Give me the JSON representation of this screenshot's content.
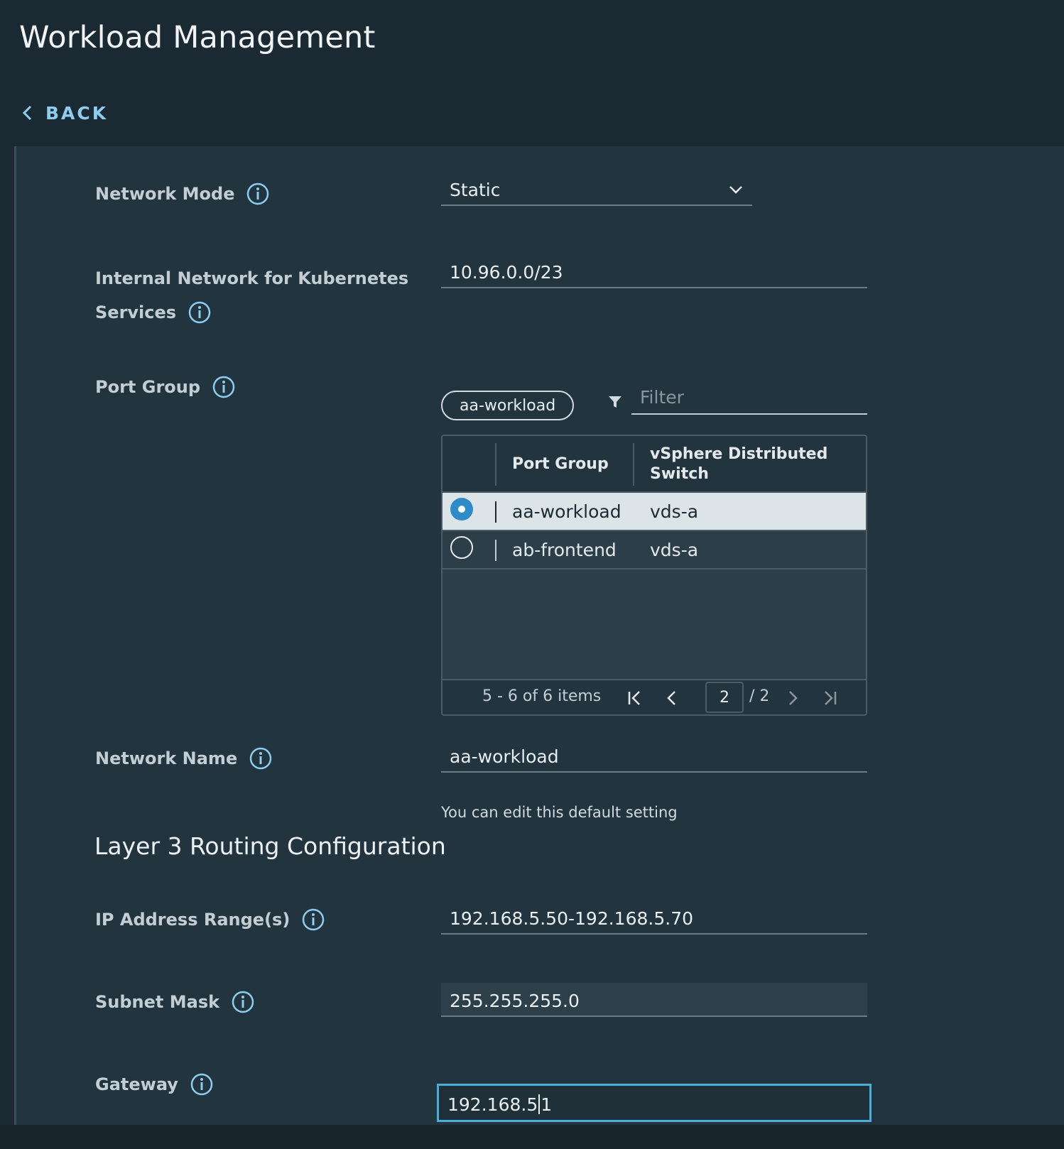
{
  "header": {
    "title": "Workload Management",
    "back_label": "BACK"
  },
  "form": {
    "network_mode": {
      "label": "Network Mode",
      "value": "Static"
    },
    "internal_network": {
      "label_line1": "Internal Network for Kubernetes",
      "label_line2": "Services",
      "value": "10.96.0.0/23"
    },
    "port_group": {
      "label": "Port Group",
      "chip": "aa-workload",
      "filter_placeholder": "Filter",
      "columns": [
        "Port Group",
        "vSphere Distributed Switch"
      ],
      "rows": [
        {
          "port_group": "aa-workload",
          "switch": "vds-a",
          "selected": true
        },
        {
          "port_group": "ab-frontend",
          "switch": "vds-a",
          "selected": false
        }
      ],
      "footer": {
        "range": "5 - 6 of 6 items",
        "page": "2",
        "total": "/ 2"
      }
    },
    "network_name": {
      "label": "Network Name",
      "value": "aa-workload",
      "helper": "You can edit this default setting"
    },
    "layer3_title": "Layer 3 Routing Configuration",
    "ip_range": {
      "label": "IP Address Range(s)",
      "value": "192.168.5.50-192.168.5.70"
    },
    "subnet_mask": {
      "label": "Subnet Mask",
      "value": "255.255.255.0"
    },
    "gateway": {
      "label": "Gateway",
      "value_before_caret": "192.168.5",
      "value_after_caret": "1"
    }
  },
  "colors": {
    "accent": "#49afd9",
    "link": "#8ccdf0",
    "background": "#1b2a32",
    "panel": "#22343e"
  },
  "icons": [
    "info-icon",
    "chevron-down-icon",
    "chevron-left-icon",
    "filter-icon",
    "radio-selected-icon",
    "radio-empty-icon",
    "first-page-icon",
    "previous-page-icon",
    "next-page-icon",
    "last-page-icon"
  ]
}
